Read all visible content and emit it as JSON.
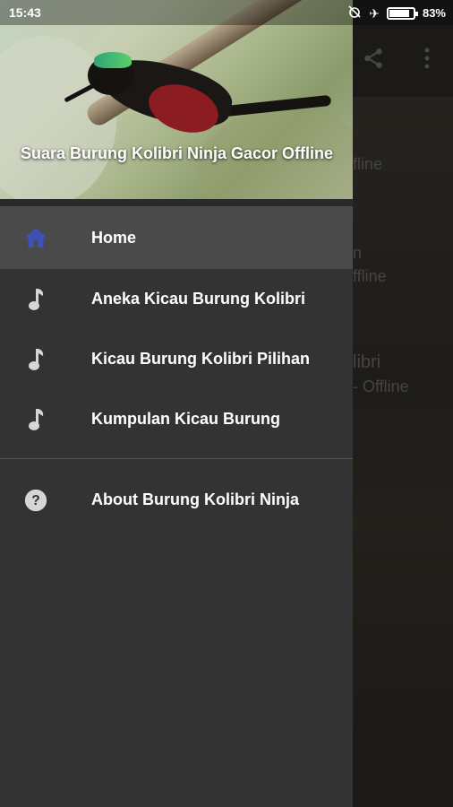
{
  "status_bar": {
    "time": "15:43",
    "battery": "83%",
    "battery_level": 0.83
  },
  "drawer": {
    "header_title": "Suara Burung Kolibri Ninja Gacor Offline",
    "menu": [
      {
        "label": "Home",
        "icon": "home-icon",
        "selected": true
      },
      {
        "label": "Aneka Kicau Burung Kolibri",
        "icon": "music-note-icon"
      },
      {
        "label": "Kicau Burung Kolibri Pilihan",
        "icon": "music-note-icon"
      },
      {
        "label": "Kumpulan Kicau Burung",
        "icon": "music-note-icon"
      }
    ],
    "about": {
      "label": "About Burung Kolibri Ninja",
      "icon": "help-icon"
    }
  },
  "background": {
    "texts": [
      "fline",
      "n",
      "ffline",
      "libri",
      "- Offline"
    ]
  },
  "colors": {
    "accent": "#3f51b5",
    "drawer_bg": "#333333",
    "selected_bg": "#4a4a4a"
  }
}
